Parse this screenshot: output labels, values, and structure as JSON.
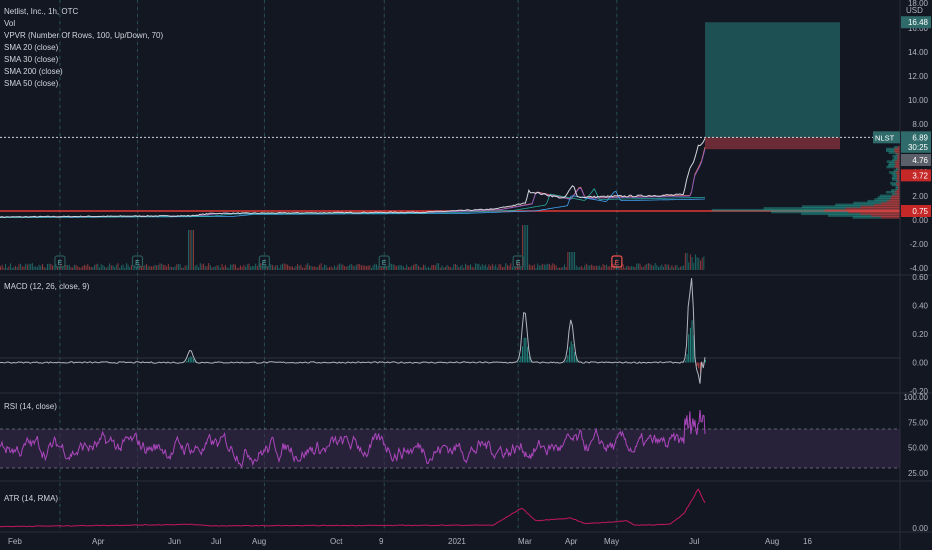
{
  "header": {
    "title": "Netlist, Inc., 1h, OTC",
    "currency": "USD",
    "indicators": [
      "Vol",
      "VPVR (Number Of Rows, 100, Up/Down, 70)",
      "SMA 20 (close)",
      "SMA 30 (close)",
      "SMA 200 (close)",
      "SMA 50 (close)"
    ]
  },
  "colors": {
    "background": "#131722",
    "grid": "#1f2330",
    "session_line": "#2a5a5a",
    "price": "#d1d4dc",
    "sma20": "#e57373",
    "sma30": "#7e57c2",
    "sma200": "#42a5f5",
    "sma50": "#26a69a",
    "support_line": "#e53935",
    "target_zone": "#1f5a5a",
    "stop_zone": "#7a2f3a",
    "rsi": "#ab47bc",
    "rsi_band": "#3a2a4f",
    "atr": "#c2185b",
    "macd_up": "#26a69a",
    "macd_down": "#ef5350",
    "signal": "#ff9800"
  },
  "chart_data": [
    {
      "type": "line",
      "panel": "price",
      "title": "Netlist, Inc., 1h, OTC",
      "x_labels": [
        "Feb",
        "Apr",
        "Jun",
        "Jul",
        "Aug",
        "Oct",
        "9",
        "2021",
        "Mar",
        "Apr",
        "May",
        "Jul",
        "Aug",
        "16"
      ],
      "ylim": [
        -4.0,
        18.0
      ],
      "y_ticks": [
        "18.00",
        "16.00",
        "14.00",
        "12.00",
        "10.00",
        "8.00",
        "6.00",
        "4.00",
        "2.00",
        "0.00",
        "-2.00",
        "-4.00"
      ],
      "series": [
        {
          "name": "NLST",
          "x_frac": [
            0.0,
            0.27,
            0.3,
            0.6,
            0.7,
            0.745,
            0.75,
            0.8,
            0.813,
            0.82,
            0.9,
            0.97,
            0.975,
            0.985,
            0.99,
            1.0
          ],
          "values": [
            0.25,
            0.35,
            0.55,
            0.65,
            0.9,
            1.4,
            2.4,
            1.8,
            2.9,
            1.9,
            2.0,
            2.1,
            3.8,
            5.0,
            6.2,
            6.89
          ]
        }
      ],
      "price_labels": [
        {
          "label": "NLST",
          "value": "6.89",
          "y_value": 6.89
        },
        {
          "value": "30:25",
          "y_value": 6.1
        },
        {
          "value": "16.48",
          "y_value": 16.48
        },
        {
          "value": "4.76",
          "y_value": 5.0
        },
        {
          "value": "3.72",
          "y_value": 3.72
        },
        {
          "value": "0.75",
          "y_value": 0.75
        }
      ],
      "horizontal_level": 0.75,
      "target_zone": {
        "top": 16.48,
        "bottom": 6.89
      },
      "stop_zone": {
        "top": 6.89,
        "bottom": 5.9
      },
      "earnings_markers": [
        "E",
        "E",
        "E",
        "E",
        "E",
        "E"
      ]
    },
    {
      "type": "bar",
      "panel": "macd",
      "title": "MACD (12, 26, close, 9)",
      "ylim": [
        -0.2,
        0.6
      ],
      "y_ticks": [
        "0.60",
        "0.40",
        "0.20",
        "0.00",
        "-0.20"
      ],
      "spikes": [
        {
          "x_frac": 0.27,
          "value": 0.09
        },
        {
          "x_frac": 0.744,
          "value": 0.37
        },
        {
          "x_frac": 0.81,
          "value": 0.3
        },
        {
          "x_frac": 0.98,
          "value": 0.55
        },
        {
          "x_frac": 0.99,
          "value": -0.17
        }
      ]
    },
    {
      "type": "line",
      "panel": "rsi",
      "title": "RSI (14, close)",
      "ylim": [
        20,
        100
      ],
      "y_ticks": [
        "100.00",
        "75.00",
        "50.00",
        "25.00"
      ],
      "bands": [
        70,
        30
      ]
    },
    {
      "type": "line",
      "panel": "atr",
      "title": "ATR (14, RMA)",
      "y_ticks": [
        "0.00"
      ],
      "x_frac": [
        0.0,
        0.27,
        0.3,
        0.7,
        0.74,
        0.76,
        0.81,
        0.83,
        0.89,
        0.9,
        0.95,
        0.97,
        0.985,
        0.99,
        1.0
      ],
      "values": [
        0.02,
        0.05,
        0.03,
        0.04,
        0.28,
        0.1,
        0.14,
        0.06,
        0.1,
        0.04,
        0.05,
        0.2,
        0.45,
        0.55,
        0.35
      ]
    }
  ]
}
